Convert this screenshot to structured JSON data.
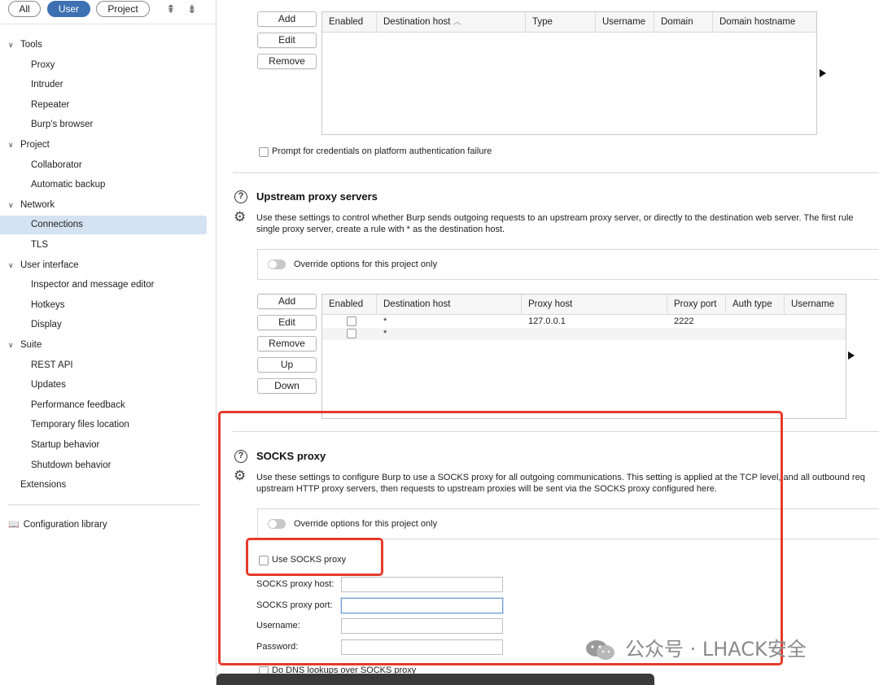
{
  "sidebar": {
    "scope_tabs": [
      "All",
      "User",
      "Project"
    ],
    "active_scope": "User",
    "tree": [
      {
        "label": "Tools",
        "level": 0,
        "expanded": true
      },
      {
        "label": "Proxy",
        "level": 1
      },
      {
        "label": "Intruder",
        "level": 1
      },
      {
        "label": "Repeater",
        "level": 1
      },
      {
        "label": "Burp's browser",
        "level": 1
      },
      {
        "label": "Project",
        "level": 0,
        "expanded": true
      },
      {
        "label": "Collaborator",
        "level": 1
      },
      {
        "label": "Automatic backup",
        "level": 1
      },
      {
        "label": "Network",
        "level": 0,
        "expanded": true
      },
      {
        "label": "Connections",
        "level": 1,
        "selected": true
      },
      {
        "label": "TLS",
        "level": 1
      },
      {
        "label": "User interface",
        "level": 0,
        "expanded": true
      },
      {
        "label": "Inspector and message editor",
        "level": 1
      },
      {
        "label": "Hotkeys",
        "level": 1
      },
      {
        "label": "Display",
        "level": 1
      },
      {
        "label": "Suite",
        "level": 0,
        "expanded": true
      },
      {
        "label": "REST API",
        "level": 1
      },
      {
        "label": "Updates",
        "level": 1
      },
      {
        "label": "Performance feedback",
        "level": 1
      },
      {
        "label": "Temporary files location",
        "level": 1
      },
      {
        "label": "Startup behavior",
        "level": 1
      },
      {
        "label": "Shutdown behavior",
        "level": 1
      },
      {
        "label": "Extensions",
        "level": 0
      }
    ],
    "config_library": "Configuration library"
  },
  "platform_auth": {
    "buttons": [
      "Add",
      "Edit",
      "Remove"
    ],
    "columns": [
      "Enabled",
      "Destination host",
      "Type",
      "Username",
      "Domain",
      "Domain hostname"
    ],
    "sort_indicator": "^",
    "prompt_checkbox_label": "Prompt for credentials on platform authentication failure",
    "prompt_checked": false
  },
  "upstream": {
    "title": "Upstream proxy servers",
    "desc_line1": "Use these settings to control whether Burp sends outgoing requests to an upstream proxy server, or directly to the destination web server. The first rule",
    "desc_line2": "single proxy server, create a rule with * as the destination host.",
    "override_label": "Override options for this project only",
    "override_on": false,
    "buttons": [
      "Add",
      "Edit",
      "Remove",
      "Up",
      "Down"
    ],
    "columns": [
      "Enabled",
      "Destination host",
      "Proxy host",
      "Proxy port",
      "Auth type",
      "Username"
    ],
    "rows": [
      {
        "enabled": false,
        "destination": "*",
        "proxy_host": "127.0.0.1",
        "proxy_port": "2222",
        "auth_type": "",
        "username": ""
      },
      {
        "enabled": false,
        "destination": "*",
        "proxy_host": "",
        "proxy_port": "",
        "auth_type": "",
        "username": ""
      }
    ]
  },
  "socks": {
    "title": "SOCKS proxy",
    "desc_line1": "Use these settings to configure Burp to use a SOCKS proxy for all outgoing communications. This setting is applied at the TCP level, and all outbound req",
    "desc_line2": "upstream HTTP proxy servers, then requests to upstream proxies will be sent via the SOCKS proxy configured here.",
    "override_label": "Override options for this project only",
    "override_on": false,
    "use_socks_label": "Use SOCKS proxy",
    "use_socks_checked": false,
    "host_label": "SOCKS proxy host:",
    "port_label": "SOCKS proxy port:",
    "username_label": "Username:",
    "password_label": "Password:",
    "host_value": "",
    "port_value": "",
    "username_value": "",
    "password_value": "",
    "dns_label": "Do DNS lookups over SOCKS proxy",
    "dns_checked": false
  },
  "watermark": "公众号 · LHACK安全",
  "colors": {
    "accent": "#3d6fb3",
    "selected_bg": "#d5e2f2",
    "highlight_red": "#e53b2c"
  }
}
